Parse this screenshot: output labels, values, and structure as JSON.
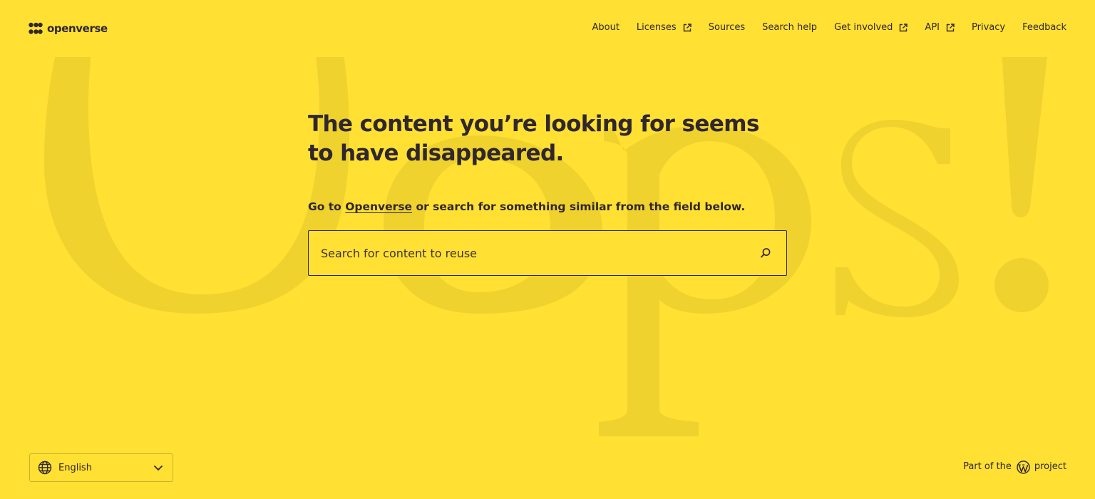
{
  "header": {
    "logo_text": "openverse",
    "nav": [
      {
        "label": "About",
        "external": false
      },
      {
        "label": "Licenses",
        "external": true
      },
      {
        "label": "Sources",
        "external": false
      },
      {
        "label": "Search help",
        "external": false
      },
      {
        "label": "Get involved",
        "external": true
      },
      {
        "label": "API",
        "external": true
      },
      {
        "label": "Privacy",
        "external": false
      },
      {
        "label": "Feedback",
        "external": false
      }
    ]
  },
  "background": {
    "text": "Oops!"
  },
  "main": {
    "heading": "The content you’re looking for seems to have disappeared.",
    "subline_prefix": "Go to ",
    "subline_link": "Openverse",
    "subline_suffix": " or search for something similar from the field below.",
    "search": {
      "placeholder": "Search for content to reuse",
      "value": ""
    }
  },
  "footer": {
    "language": "English",
    "credit_prefix": "Part of the",
    "credit_suffix": "project"
  },
  "colors": {
    "background": "#ffe033",
    "text": "#30272e",
    "decorative": "#f0d430"
  },
  "icons": {
    "logo": "openverse-logo-icon",
    "external": "external-link-icon",
    "search": "search-icon",
    "language": "globe-icon",
    "dropdown": "chevron-down-icon",
    "wordpress": "wordpress-icon"
  }
}
